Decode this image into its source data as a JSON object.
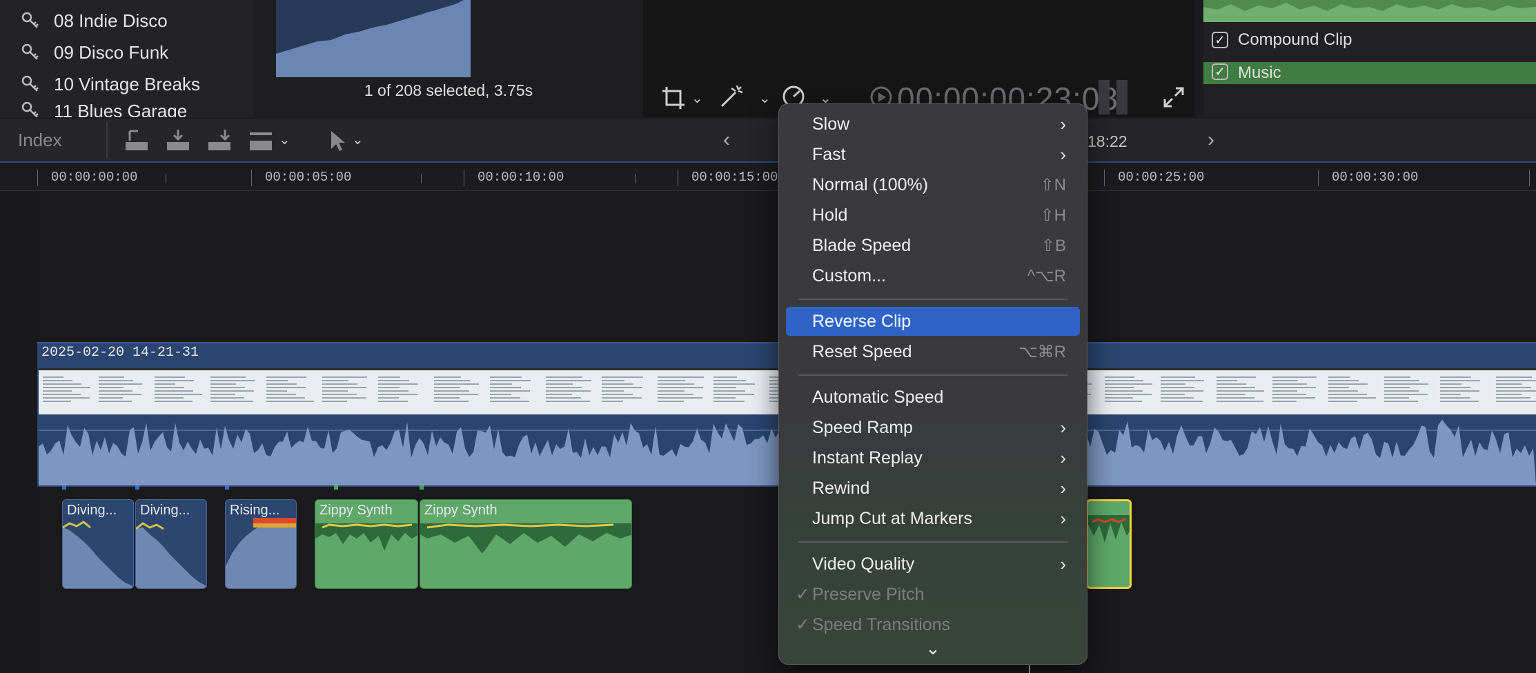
{
  "library": {
    "items": [
      {
        "label": "08 Indie Disco"
      },
      {
        "label": "09 Disco Funk"
      },
      {
        "label": "10 Vintage Breaks"
      },
      {
        "label": "11 Blues Garage"
      }
    ]
  },
  "browser": {
    "selection_status": "1 of 208 selected, 3.75s"
  },
  "viewer": {
    "timecode": "00:00:00:23:08"
  },
  "inspector": {
    "rows": [
      {
        "label": "Compound Clip",
        "checked": true
      },
      {
        "label": "Music",
        "checked": true
      }
    ]
  },
  "toolbar": {
    "index_label": "Index",
    "timecode_partial": "18:22"
  },
  "ruler": {
    "timecodes": [
      "00:00:00:00",
      "00:00:05:00",
      "00:00:10:00",
      "00:00:15:00",
      "00:00:25:00",
      "00:00:30:00"
    ]
  },
  "timeline": {
    "primary_clip_name": "2025-02-20 14-21-31",
    "music_clips": [
      {
        "label": "Diving..."
      },
      {
        "label": "Diving..."
      },
      {
        "label": "Rising..."
      },
      {
        "label": "Zippy Synth"
      },
      {
        "label": "Zippy Synth"
      }
    ]
  },
  "menu": {
    "items": [
      {
        "label": "Slow",
        "submenu": true
      },
      {
        "label": "Fast",
        "submenu": true
      },
      {
        "label": "Normal (100%)",
        "shortcut": "⇧N"
      },
      {
        "label": "Hold",
        "shortcut": "⇧H"
      },
      {
        "label": "Blade Speed",
        "shortcut": "⇧B"
      },
      {
        "label": "Custom...",
        "shortcut": "^⌥R"
      },
      {
        "label": "Reverse Clip",
        "highlighted": true
      },
      {
        "label": "Reset Speed",
        "shortcut": "⌥⌘R"
      },
      {
        "label": "Automatic Speed"
      },
      {
        "label": "Speed Ramp",
        "submenu": true
      },
      {
        "label": "Instant Replay",
        "submenu": true
      },
      {
        "label": "Rewind",
        "submenu": true
      },
      {
        "label": "Jump Cut at Markers",
        "submenu": true
      },
      {
        "label": "Video Quality",
        "submenu": true
      },
      {
        "label": "Preserve Pitch",
        "checked": true,
        "disabled": true
      },
      {
        "label": "Speed Transitions",
        "checked": true,
        "disabled": true
      }
    ],
    "scroll_indicator": "⌄"
  },
  "colors": {
    "highlight": "#2f64c6",
    "primary_clip": "#2a4570",
    "music_clip": "#5fa86a",
    "selected_outline": "#f2d43a"
  }
}
